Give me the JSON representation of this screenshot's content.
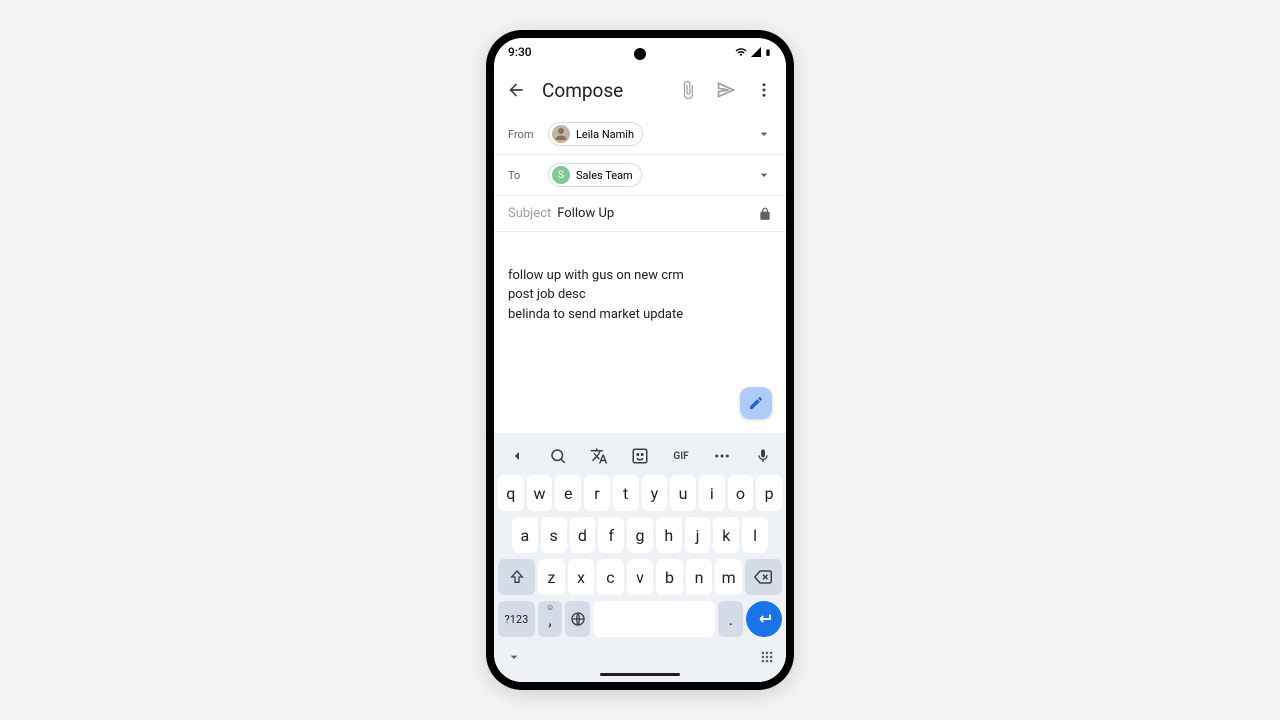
{
  "status": {
    "time": "9:30"
  },
  "appbar": {
    "title": "Compose"
  },
  "from": {
    "label": "From",
    "name": "Leila Namih"
  },
  "to": {
    "label": "To",
    "name": "Sales Team",
    "initial": "S"
  },
  "subject": {
    "label": "Subject",
    "value": "Follow Up"
  },
  "body": "follow up with gus on new crm\npost job desc\nbelinda to send market update",
  "keyboard": {
    "gif": "GIF",
    "row1": [
      "q",
      "w",
      "e",
      "r",
      "t",
      "y",
      "u",
      "i",
      "o",
      "p"
    ],
    "row2": [
      "a",
      "s",
      "d",
      "f",
      "g",
      "h",
      "j",
      "k",
      "l"
    ],
    "row3": [
      "z",
      "x",
      "c",
      "v",
      "b",
      "n",
      "m"
    ],
    "numkey": "?123",
    "comma": ",",
    "period": "."
  }
}
